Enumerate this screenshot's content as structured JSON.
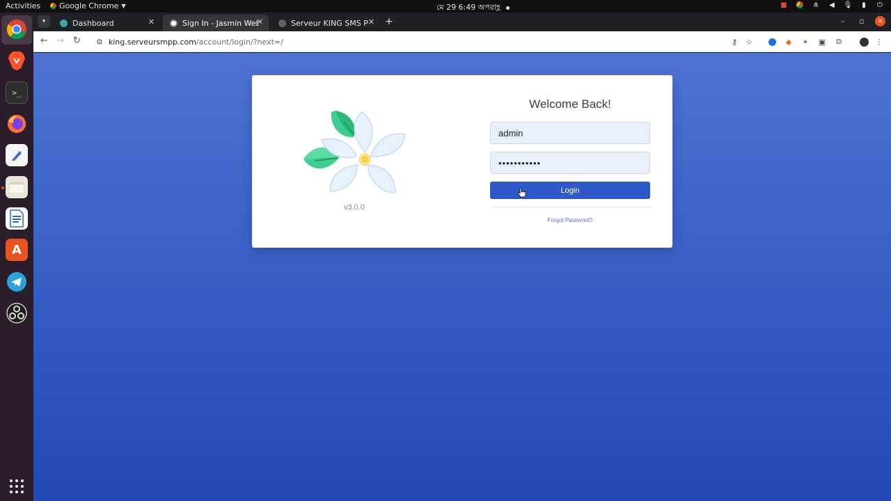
{
  "topbar": {
    "activities": "Activities",
    "app_name": "Google Chrome",
    "clock": "মে 29  6:49 অপরাহ্ণ"
  },
  "dock": {
    "items": [
      "chrome-icon",
      "brave-icon",
      "terminal-icon",
      "firefox-icon",
      "text-editor-icon",
      "files-icon",
      "writer-icon",
      "app-center-icon",
      "telegram-icon",
      "obs-icon"
    ]
  },
  "tabs": [
    {
      "title": "Dashboard"
    },
    {
      "title": "Sign In - Jasmin Web Panel"
    },
    {
      "title": "Serveur KING SMS PRO"
    }
  ],
  "address_bar": {
    "host": "king.serveursmpp.com",
    "path": "/account/login/?next=/"
  },
  "login": {
    "version": "v3.0.0",
    "heading": "Welcome Back!",
    "username_value": "admin",
    "password_value": "•••••••••••",
    "login_label": "Login",
    "forgot_label": "Forgot Password?"
  },
  "colors": {
    "accent": "#2f58c8",
    "page_bg_top": "#4e73d3",
    "page_bg_bottom": "#2348b3"
  }
}
